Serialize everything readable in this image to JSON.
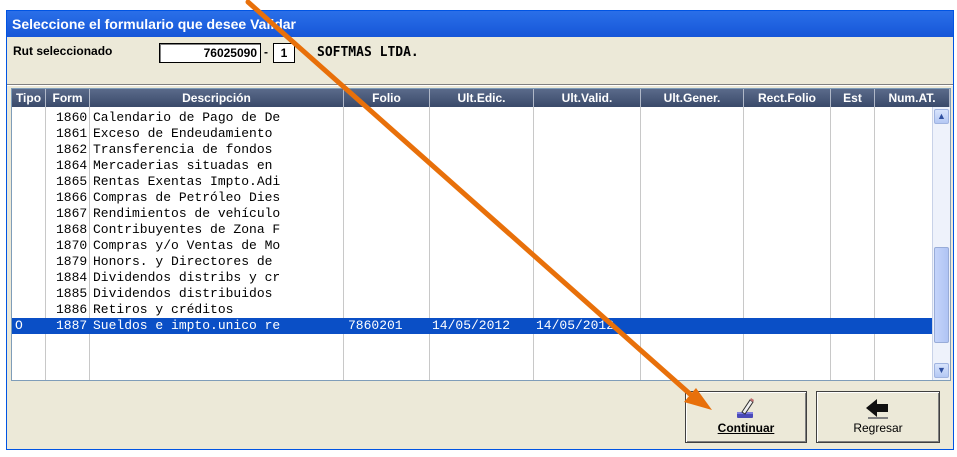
{
  "window": {
    "title": "Seleccione el formulario que desee Validar"
  },
  "rut": {
    "label": "Rut seleccionado",
    "value": "76025090",
    "separator": "-",
    "dv": "1",
    "company": "SOFTMAS LTDA."
  },
  "table": {
    "headers": [
      "Tipo",
      "Form",
      "Descripción",
      "Folio",
      "Ult.Edic.",
      "Ult.Valid.",
      "Ult.Gener.",
      "Rect.Folio",
      "Est",
      "Num.AT."
    ],
    "rows": [
      {
        "tipo": "",
        "form": "1860",
        "desc": "Calendario de Pago de De",
        "folio": "",
        "edic": "",
        "valid": ""
      },
      {
        "tipo": "",
        "form": "1861",
        "desc": "Exceso de Endeudamiento",
        "folio": "",
        "edic": "",
        "valid": ""
      },
      {
        "tipo": "",
        "form": "1862",
        "desc": "Transferencia de fondos",
        "folio": "",
        "edic": "",
        "valid": ""
      },
      {
        "tipo": "",
        "form": "1864",
        "desc": "Mercaderias situadas en",
        "folio": "",
        "edic": "",
        "valid": ""
      },
      {
        "tipo": "",
        "form": "1865",
        "desc": "Rentas Exentas Impto.Adi",
        "folio": "",
        "edic": "",
        "valid": ""
      },
      {
        "tipo": "",
        "form": "1866",
        "desc": "Compras de Petróleo Dies",
        "folio": "",
        "edic": "",
        "valid": ""
      },
      {
        "tipo": "",
        "form": "1867",
        "desc": "Rendimientos de vehículo",
        "folio": "",
        "edic": "",
        "valid": ""
      },
      {
        "tipo": "",
        "form": "1868",
        "desc": "Contribuyentes de Zona F",
        "folio": "",
        "edic": "",
        "valid": ""
      },
      {
        "tipo": "",
        "form": "1870",
        "desc": "Compras y/o Ventas de Mo",
        "folio": "",
        "edic": "",
        "valid": ""
      },
      {
        "tipo": "",
        "form": "1879",
        "desc": "Honors. y Directores de",
        "folio": "",
        "edic": "",
        "valid": ""
      },
      {
        "tipo": "",
        "form": "1884",
        "desc": "Dividendos distribs y cr",
        "folio": "",
        "edic": "",
        "valid": ""
      },
      {
        "tipo": "",
        "form": "1885",
        "desc": "Dividendos distribuidos",
        "folio": "",
        "edic": "",
        "valid": ""
      },
      {
        "tipo": "",
        "form": "1886",
        "desc": "Retiros y créditos",
        "folio": "",
        "edic": "",
        "valid": ""
      },
      {
        "tipo": "O",
        "form": "1887",
        "desc": "Sueldos e impto.unico re",
        "folio": "7860201",
        "edic": "14/05/2012",
        "valid": "14/05/2012",
        "selected": true
      }
    ]
  },
  "buttons": {
    "continuar": "Continuar",
    "regresar": "Regresar"
  },
  "colors": {
    "titlebar": "#1656d8",
    "selection": "#0a4fc6",
    "annotation_arrow": "#e8700a",
    "dialog_bg": "#ece9d8"
  },
  "icons": {
    "continuar": "pencil-eraser-icon",
    "regresar": "back-arrow-icon",
    "scroll_up": "chevron-up-icon",
    "scroll_down": "chevron-down-icon"
  }
}
